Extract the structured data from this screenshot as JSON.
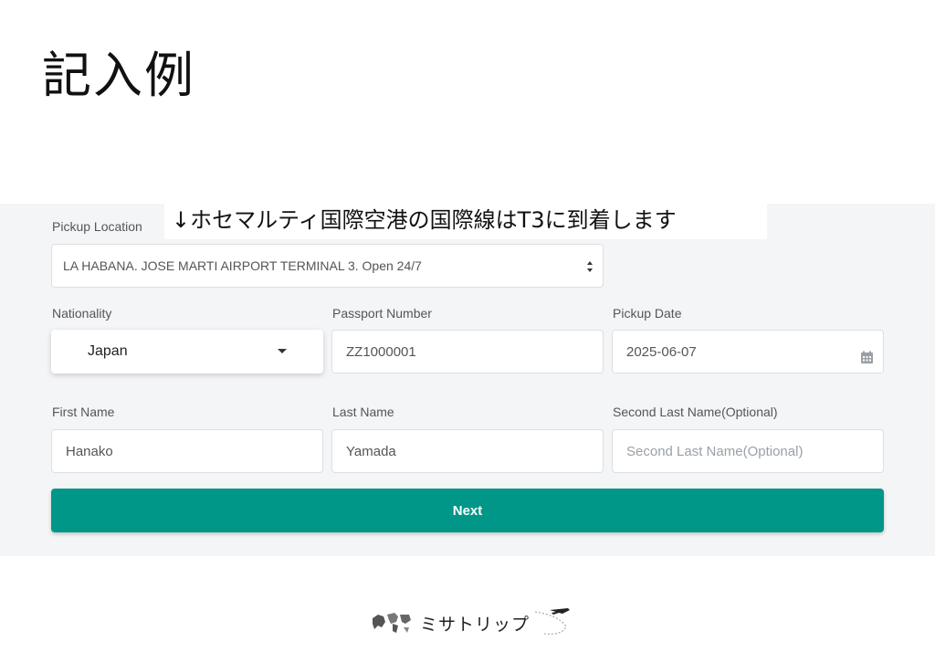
{
  "page_title": "記入例",
  "annotation": "↓ホセマルティ国際空港の国際線はT3に到着します",
  "form": {
    "pickup_location": {
      "label": "Pickup Location",
      "value": "LA HABANA. JOSE MARTI AIRPORT TERMINAL 3. Open 24/7"
    },
    "nationality": {
      "label": "Nationality",
      "value": "Japan"
    },
    "passport_number": {
      "label": "Passport Number",
      "value": "ZZ1000001"
    },
    "pickup_date": {
      "label": "Pickup Date",
      "value": "2025-06-07"
    },
    "first_name": {
      "label": "First Name",
      "value": "Hanako"
    },
    "last_name": {
      "label": "Last Name",
      "value": "Yamada"
    },
    "second_last_name": {
      "label": "Second Last Name(Optional)",
      "placeholder": "Second Last Name(Optional)"
    },
    "next_label": "Next"
  },
  "footer": {
    "brand": "ミサトリップ",
    "icons": [
      "world-map-icon",
      "airplane-icon"
    ]
  },
  "colors": {
    "accent": "#009688",
    "panel_bg": "#f4f5f7"
  }
}
